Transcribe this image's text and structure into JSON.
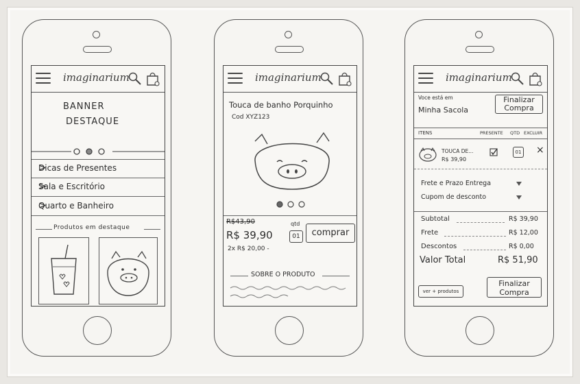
{
  "phone1": {
    "logo": "imaginarium",
    "banner_line1": "BANNER",
    "banner_line2": "DESTAQUE",
    "nav_items": [
      {
        "label": "Dicas de Presentes",
        "chevron": ">"
      },
      {
        "label": "Sala e Escritório",
        "chevron": ">"
      },
      {
        "label": "Quarto e Banheiro",
        "chevron": ">"
      }
    ],
    "featured_heading": "Produtos em destaque"
  },
  "phone2": {
    "logo": "imaginarium",
    "product_title": "Touca de banho Porquinho",
    "product_code": "Cod XYZ123",
    "old_price": "R$43,90",
    "price": "R$ 39,90",
    "installments": "2x R$ 20,00 -",
    "qty_label": "qtd",
    "qty_value": "01",
    "buy_label": "comprar",
    "about_label": "SOBRE O PRODUTO"
  },
  "phone3": {
    "logo": "imaginarium",
    "location_label": "Voce está em",
    "location_value": "Minha Sacola",
    "checkout_top": "Finalizar Compra",
    "col_items": "ITENS",
    "col_gift": "PRESENTE",
    "col_qty": "QTD",
    "col_remove": "EXCLUIR",
    "item_name": "TOUCA DE...",
    "item_price": "R$ 39,90",
    "item_qty": "01",
    "remove_glyph": "×",
    "shipping_label": "Frete e Prazo Entrega",
    "coupon_label": "Cupom de desconto",
    "subtotal_label": "Subtotal",
    "subtotal_value": "R$ 39,90",
    "frete_label": "Frete",
    "frete_value": "R$ 12,00",
    "discount_label": "Descontos",
    "discount_value": "R$ 0,00",
    "total_label": "Valor Total",
    "total_value": "R$ 51,90",
    "more_products": "ver + produtos",
    "checkout_bottom": "Finalizar Compra"
  }
}
